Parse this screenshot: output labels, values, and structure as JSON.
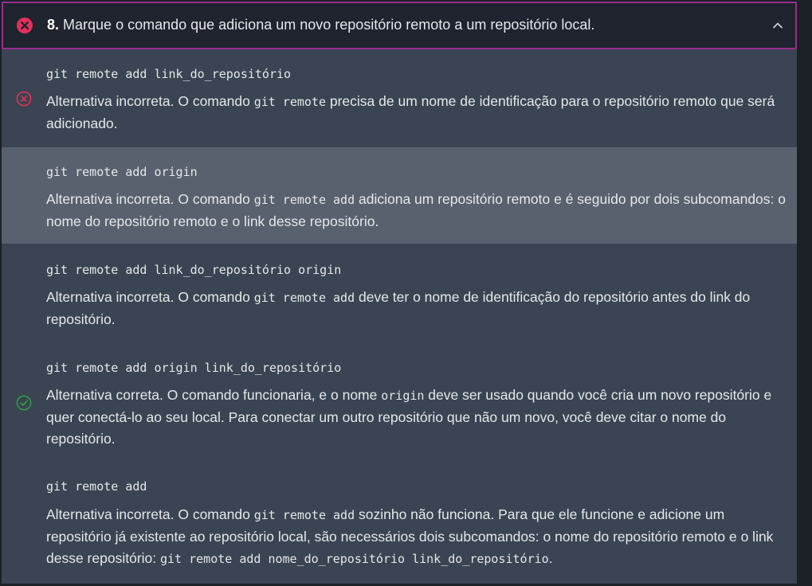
{
  "question": {
    "number": "8.",
    "text": "Marque o comando que adiciona um novo repositório remoto a um repositório local.",
    "status": "incorrect"
  },
  "alternatives": [
    {
      "code": "git remote add link_do_repositório",
      "status": "incorrect-selected",
      "feedback": {
        "p1": "Alternativa incorreta. O comando ",
        "c1": "git remote",
        "p2": " precisa de um nome de identificação para o repositório remoto que será adicionado."
      }
    },
    {
      "code": "git remote add origin",
      "status": "neutral",
      "feedback": {
        "p1": "Alternativa incorreta. O comando ",
        "c1": "git remote add",
        "p2": " adiciona um repositório remoto e é seguido por dois subcomandos: o nome do repositório remoto e o link desse repositório."
      }
    },
    {
      "code": "git remote add link_do_repositório origin",
      "status": "neutral",
      "feedback": {
        "p1": "Alternativa incorreta. O comando ",
        "c1": "git remote add",
        "p2": " deve ter o nome de identificação do repositório antes do link do repositório."
      }
    },
    {
      "code": "git remote add origin link_do_repositório",
      "status": "correct",
      "feedback": {
        "p1": "Alternativa correta. O comando funcionaria, e o nome ",
        "c1": "origin",
        "p2": " deve ser usado quando você cria um novo repositório e quer conectá-lo ao seu local. Para conectar um outro repositório que não um novo, você deve citar o nome do repositório."
      }
    },
    {
      "code": "git remote add",
      "status": "neutral",
      "feedback": {
        "p1": "Alternativa incorreta. O comando ",
        "c1": "git remote add",
        "p2": " sozinho não funciona. Para que ele funcione e adicione um repositório já existente ao repositório local, são necessários dois subcomandos: o nome do repositório remoto e o link desse repositório: ",
        "c2": "git remote add nome_do_repositório link_do_repositório",
        "p3": "."
      }
    }
  ],
  "icons": {
    "header_status": "x-circle-filled-icon",
    "chevron": "chevron-up-icon",
    "incorrect": "x-circle-outline-icon",
    "correct": "check-circle-outline-icon"
  },
  "colors": {
    "incorrect": "#e5305a",
    "correct": "#2ea043",
    "border_accent": "#9b2d8f"
  }
}
